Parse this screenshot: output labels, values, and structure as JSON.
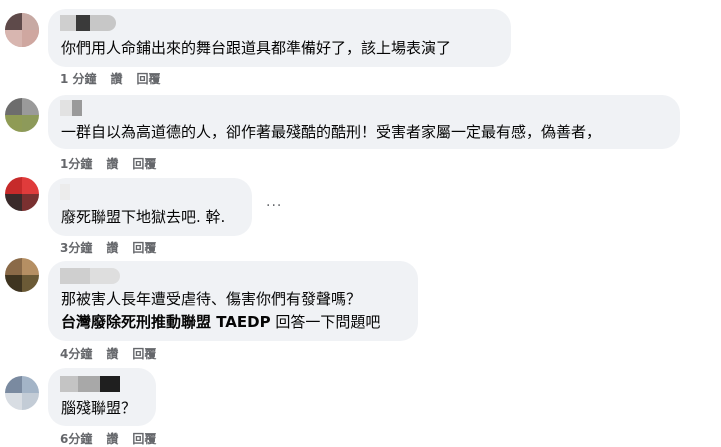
{
  "comments": [
    {
      "text": "你們用人命鋪出來的舞台跟道具都準備好了，該上場表演了",
      "time": "1 分鐘",
      "like": "讚",
      "reply": "回覆"
    },
    {
      "text": "一群自以為高道德的人，卻作著最殘酷的酷刑！受害者家屬一定最有感，偽善者，",
      "time": "1分鐘",
      "like": "讚",
      "reply": "回覆"
    },
    {
      "text": "廢死聯盟下地獄去吧. 幹.",
      "time": "3分鐘",
      "like": "讚",
      "reply": "回覆",
      "more": "···"
    },
    {
      "line1": "那被害人長年遭受虐待、傷害你們有發聲嗎？",
      "mention": "台灣廢除死刑推動聯盟 TAEDP",
      "line2_rest": " 回答一下問題吧",
      "time": "4分鐘",
      "like": "讚",
      "reply": "回覆"
    },
    {
      "text": "腦殘聯盟？",
      "time": "6分鐘",
      "like": "讚",
      "reply": "回覆"
    }
  ],
  "colors": {
    "bubble": "#f0f2f5",
    "meta_text": "#65676b",
    "body_text": "#050505"
  }
}
